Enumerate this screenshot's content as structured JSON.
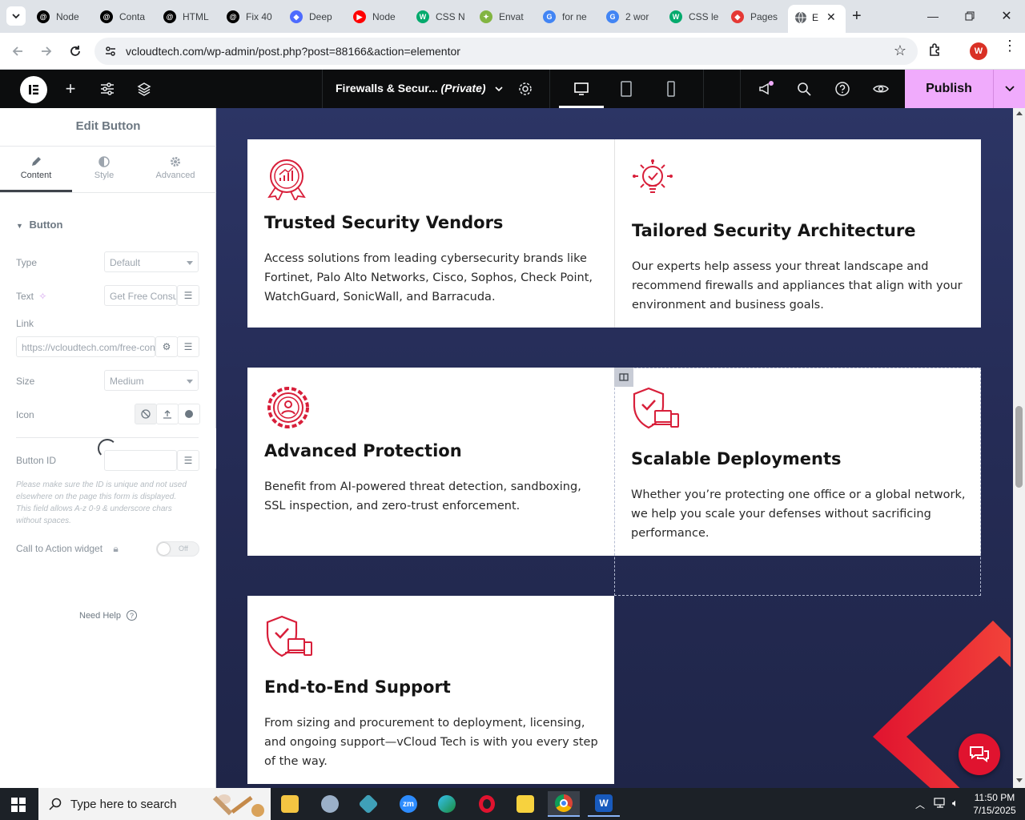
{
  "browser": {
    "tabs": [
      {
        "label": "Node",
        "icon": "threads-icon",
        "color": "#000000"
      },
      {
        "label": "Conta",
        "icon": "threads-icon",
        "color": "#000000"
      },
      {
        "label": "HTML",
        "icon": "threads-icon",
        "color": "#000000"
      },
      {
        "label": "Fix 40",
        "icon": "threads-icon",
        "color": "#000000"
      },
      {
        "label": "Deep",
        "icon": "deepseek-icon",
        "color": "#4d6bfe"
      },
      {
        "label": "Node",
        "icon": "youtube-icon",
        "color": "#ff0000"
      },
      {
        "label": "CSS N",
        "icon": "w3schools-icon",
        "color": "#04aa6d"
      },
      {
        "label": "Envat",
        "icon": "envato-icon",
        "color": "#82b541"
      },
      {
        "label": "for ne",
        "icon": "google-icon",
        "color": "#4285f4"
      },
      {
        "label": "2 wor",
        "icon": "google-icon",
        "color": "#4285f4"
      },
      {
        "label": "CSS le",
        "icon": "w3schools-icon",
        "color": "#04aa6d"
      },
      {
        "label": "Pages",
        "icon": "diamond-icon",
        "color": "#e53935"
      }
    ],
    "active_tab": {
      "label": "E",
      "icon": "globe-icon"
    },
    "url": "vcloudtech.com/wp-admin/post.php?post=88166&action=elementor",
    "profile_initial": "W"
  },
  "elementor": {
    "page_title": "Firewalls & Secur...",
    "page_status": "(Private)",
    "publish_label": "Publish"
  },
  "panel": {
    "title": "Edit Button",
    "tabs": [
      {
        "label": "Content"
      },
      {
        "label": "Style"
      },
      {
        "label": "Advanced"
      }
    ],
    "section": "Button",
    "type_label": "Type",
    "type_value": "Default",
    "text_label": "Text",
    "text_value": "Get Free Consu",
    "link_label": "Link",
    "link_value": "https://vcloudtech.com/free-con",
    "size_label": "Size",
    "size_value": "Medium",
    "icon_label": "Icon",
    "button_id_label": "Button ID",
    "note": "Please make sure the ID is unique and not used elsewhere on the page this form is displayed. This field allows A-z 0-9 & underscore chars without spaces.",
    "cta_label": "Call to Action widget",
    "cta_toggle": "Off",
    "help": "Need Help"
  },
  "cards": [
    {
      "title": "Trusted Security Vendors",
      "icon": "award-chart-icon",
      "text": "Access solutions from leading cybersecurity brands like Fortinet, Palo Alto Networks, Cisco, Sophos, Check Point, WatchGuard, SonicWall, and Barracuda."
    },
    {
      "title": "Tailored Security Architecture",
      "icon": "lightbulb-check-icon",
      "text": "Our experts help assess your threat landscape and recommend firewalls and appliances that align with your environment and business goals."
    },
    {
      "title": "Advanced Protection",
      "icon": "gear-user-icon",
      "text": "Benefit from AI-powered threat detection, sandboxing, SSL inspection, and zero-trust enforcement."
    },
    {
      "title": "Scalable Deployments",
      "icon": "shield-devices-icon",
      "text": "Whether you’re protecting one office or a global network, we help you scale your defenses without sacrificing performance."
    },
    {
      "title": "End-to-End Support",
      "icon": "shield-devices-icon",
      "text": "From sizing and procurement to deployment, licensing, and ongoing support—vCloud Tech is with you every step of the way."
    }
  ],
  "taskbar": {
    "search_placeholder": "Type here to search",
    "time": "11:50 PM",
    "date": "7/15/2025"
  },
  "colors": {
    "accent_red": "#e11d48",
    "publish_pink": "#f0abfc",
    "canvas_navy": "#262d58"
  }
}
